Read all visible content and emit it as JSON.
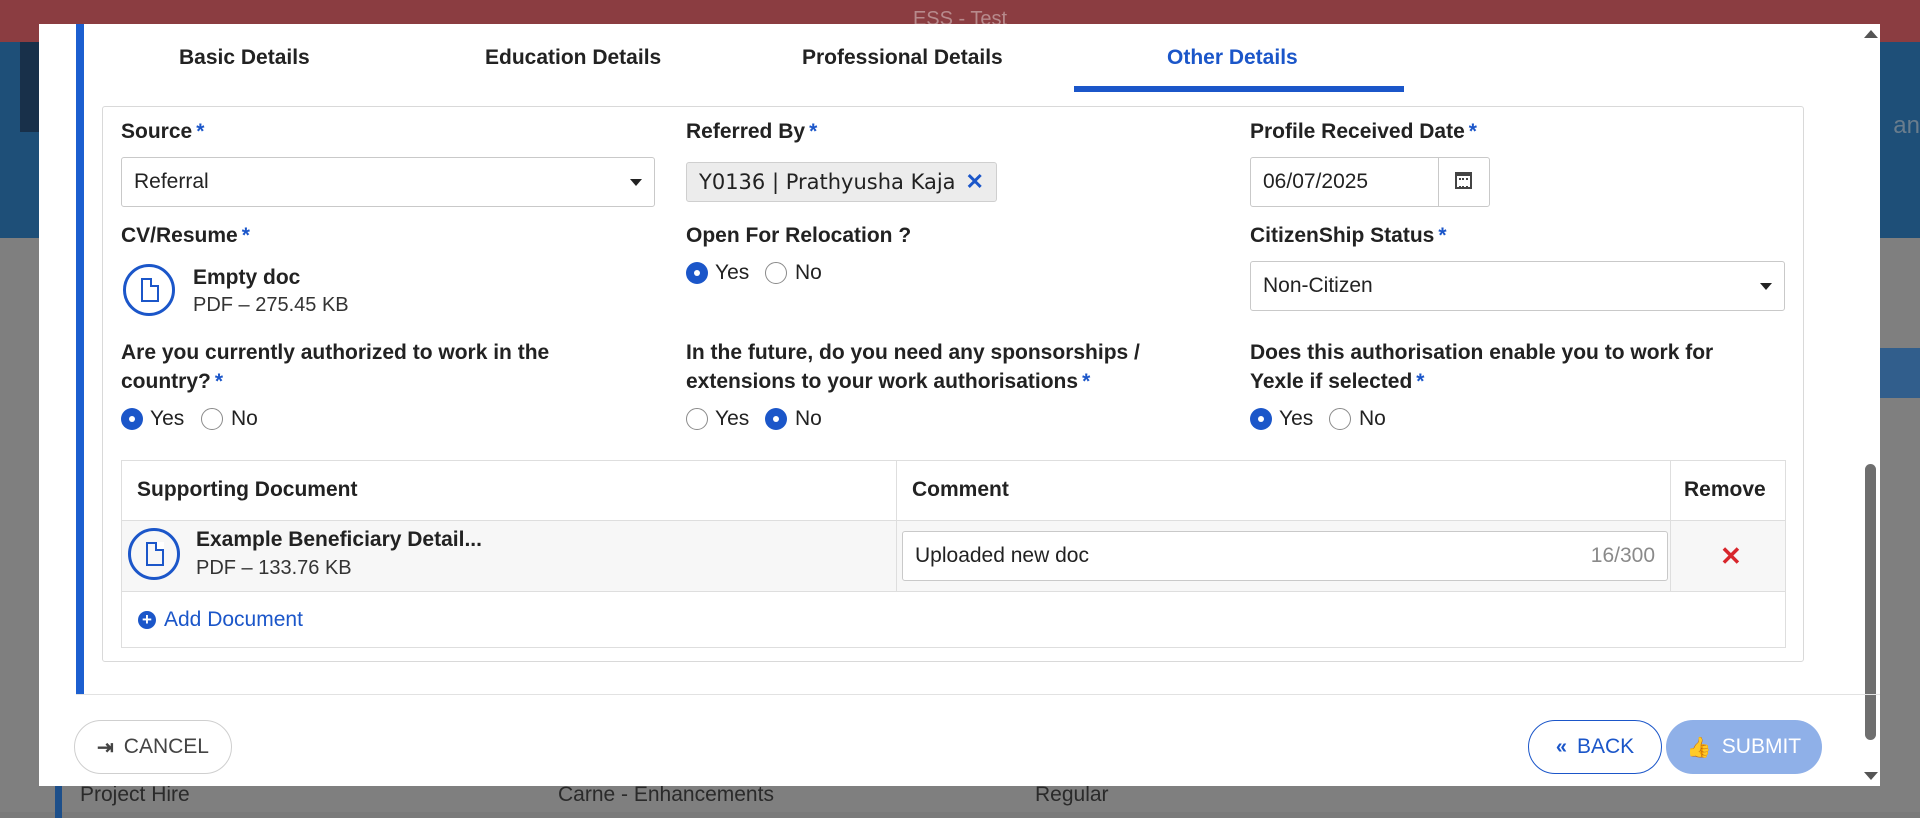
{
  "window": {
    "title": "ESS - Test"
  },
  "background": {
    "row": {
      "c1": "Project Hire",
      "c2": "Carne - Enhancements",
      "c3": "Regular"
    },
    "header_right": "an"
  },
  "tabs": [
    {
      "label": "Basic Details",
      "active": false
    },
    {
      "label": "Education Details",
      "active": false
    },
    {
      "label": "Professional Details",
      "active": false
    },
    {
      "label": "Other Details",
      "active": true
    }
  ],
  "form": {
    "source": {
      "label": "Source",
      "value": "Referral"
    },
    "referred_by": {
      "label": "Referred By",
      "chip": "Y0136 | Prathyusha Kaja"
    },
    "profile_received": {
      "label": "Profile Received Date",
      "value": "06/07/2025"
    },
    "cv": {
      "label": "CV/Resume",
      "file_name": "Empty doc",
      "file_meta": "PDF – 275.45 KB"
    },
    "relocation": {
      "label": "Open For Relocation ?",
      "yes": "Yes",
      "no": "No",
      "selected": "Yes"
    },
    "citizenship": {
      "label": "CitizenShip Status",
      "value": "Non-Citizen"
    },
    "authorized": {
      "label_line1": "Are you currently authorized to work in the",
      "label_line2": "country?",
      "yes": "Yes",
      "no": "No",
      "selected": "Yes"
    },
    "sponsorship": {
      "label_line1": "In the future, do you need any sponsorships /",
      "label_line2": "extensions to your work authorisations",
      "yes": "Yes",
      "no": "No",
      "selected": "No"
    },
    "authorisation_enable": {
      "label_line1": "Does this authorisation enable you to work for",
      "label_line2": "Yexle if selected",
      "yes": "Yes",
      "no": "No",
      "selected": "Yes"
    },
    "required_mark": "*"
  },
  "documents": {
    "headers": {
      "doc": "Supporting Document",
      "comment": "Comment",
      "remove": "Remove"
    },
    "rows": [
      {
        "name": "Example Beneficiary Detail...",
        "meta": "PDF – 133.76 KB",
        "comment": "Uploaded new doc",
        "count": "16/300"
      }
    ],
    "add_label": "Add Document"
  },
  "footer": {
    "cancel": "CANCEL",
    "back": "BACK",
    "submit": "SUBMIT"
  },
  "colors": {
    "accent": "#1b56c9",
    "danger": "#d8262c",
    "titlebar": "#8b3d41"
  },
  "icons": [
    "document-icon",
    "calendar-icon",
    "close-icon",
    "plus-circle-icon",
    "sign-out-icon",
    "double-chevron-left-icon",
    "thumbs-up-icon"
  ]
}
